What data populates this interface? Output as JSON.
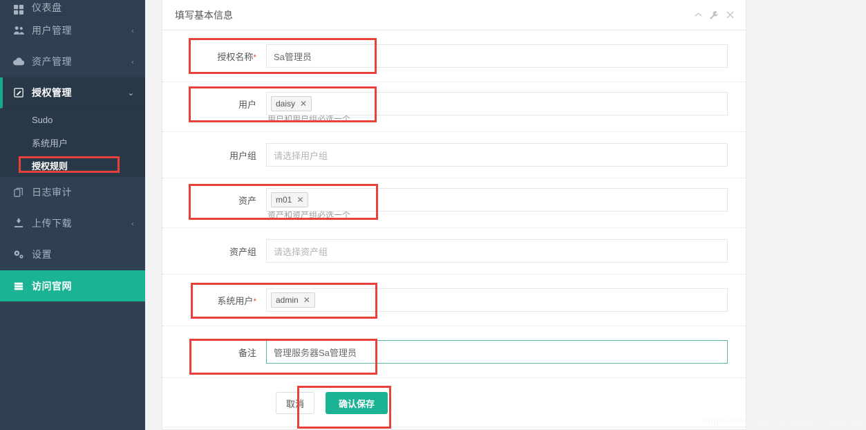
{
  "colors": {
    "sidebar_bg": "#2f4050",
    "sidebar_sub_bg": "#293846",
    "accent_green": "#1ab394",
    "annotation_red": "#e8413a",
    "focus_border": "#5bb6a8",
    "label_text": "#555555",
    "hint_text": "#9a9a9a"
  },
  "sidebar": {
    "items": [
      {
        "label": "仪表盘",
        "icon": "dashboard-icon",
        "arrow": "",
        "state": "partial"
      },
      {
        "label": "用户管理",
        "icon": "users-icon",
        "arrow": "‹",
        "state": "normal"
      },
      {
        "label": "资产管理",
        "icon": "cloud-icon",
        "arrow": "‹",
        "state": "normal"
      },
      {
        "label": "授权管理",
        "icon": "edit-square-icon",
        "arrow": "⌄",
        "state": "expanded"
      }
    ],
    "sub_items": [
      {
        "label": "Sudo",
        "highlighted": false
      },
      {
        "label": "系统用户",
        "highlighted": false
      },
      {
        "label": "授权规则",
        "highlighted": true
      }
    ],
    "items_after": [
      {
        "label": "日志审计",
        "icon": "audit-icon",
        "arrow": "",
        "state": "normal"
      },
      {
        "label": "上传下载",
        "icon": "download-icon",
        "arrow": "‹",
        "state": "normal"
      },
      {
        "label": "设置",
        "icon": "gears-icon",
        "arrow": "",
        "state": "normal"
      },
      {
        "label": "访问官网",
        "icon": "server-icon",
        "arrow": "",
        "state": "green"
      }
    ]
  },
  "panel": {
    "title": "填写基本信息",
    "tools": [
      {
        "name": "collapse-icon",
        "glyph": "⌃"
      },
      {
        "name": "wrench-icon",
        "glyph": "🔧"
      },
      {
        "name": "close-icon",
        "glyph": "✕"
      }
    ]
  },
  "form": {
    "rows": [
      {
        "label": "授权名称",
        "required": true,
        "type": "text",
        "value": "Sa管理员",
        "placeholder": "",
        "hint": "",
        "annotated": true
      },
      {
        "label": "用户",
        "required": false,
        "type": "tags",
        "tags": [
          "daisy"
        ],
        "placeholder": "",
        "hint": "用户和用户组必选一个",
        "annotated": true
      },
      {
        "label": "用户组",
        "required": false,
        "type": "select",
        "value": "",
        "placeholder": "请选择用户组",
        "hint": "",
        "annotated": false
      },
      {
        "label": "资产",
        "required": false,
        "type": "tags",
        "tags": [
          "m01"
        ],
        "placeholder": "",
        "hint": "资产和资产组必选一个",
        "annotated": true
      },
      {
        "label": "资产组",
        "required": false,
        "type": "select",
        "value": "",
        "placeholder": "请选择资产组",
        "hint": "",
        "annotated": false
      },
      {
        "label": "系统用户",
        "required": true,
        "type": "tags",
        "tags": [
          "admin"
        ],
        "placeholder": "",
        "hint": "",
        "annotated": true
      },
      {
        "label": "备注",
        "required": false,
        "type": "textarea",
        "value": "管理服务器Sa管理员",
        "placeholder": "",
        "hint": "",
        "annotated": true,
        "focused": true
      }
    ],
    "buttons": {
      "cancel": "取消",
      "save": "确认保存"
    }
  },
  "watermark": "https://blog.csdn.net/weixin_43304304"
}
